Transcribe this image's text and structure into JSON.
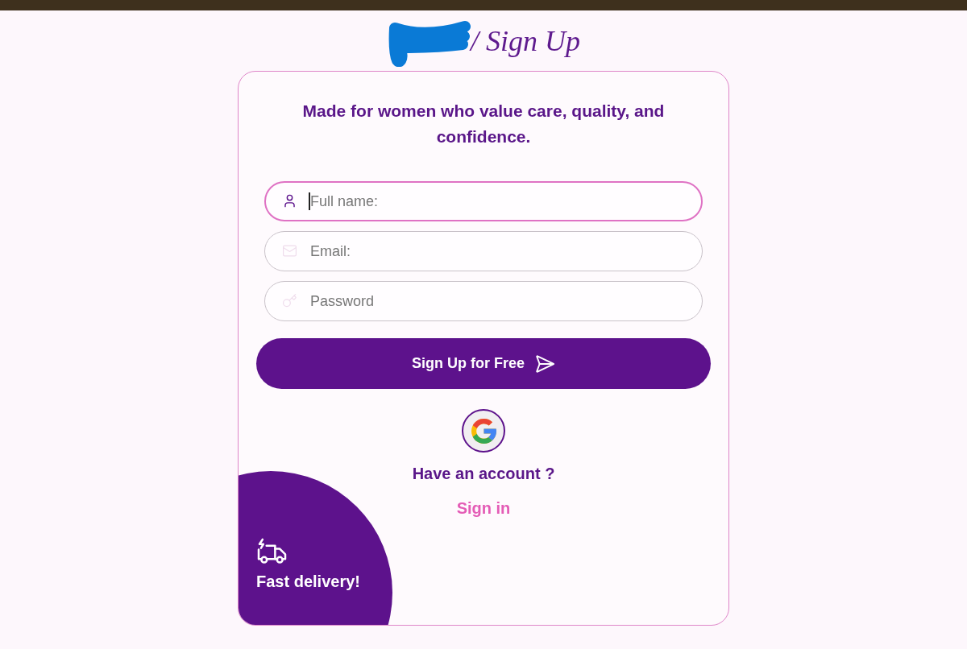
{
  "header": {
    "title": "/ Sign Up"
  },
  "card": {
    "tagline": "Made for women who value care, quality, and confidence.",
    "fields": [
      {
        "kind": "name",
        "placeholder": "Full name:",
        "focused": true
      },
      {
        "kind": "email",
        "placeholder": "Email:",
        "focused": false
      },
      {
        "kind": "password",
        "placeholder": "Password",
        "focused": false
      }
    ],
    "submit_button": {
      "label": "Sign Up for Free"
    },
    "account_prompt": "Have an account ?",
    "sign_in_link": "Sign in",
    "promo": {
      "label": "Fast delivery!"
    }
  }
}
